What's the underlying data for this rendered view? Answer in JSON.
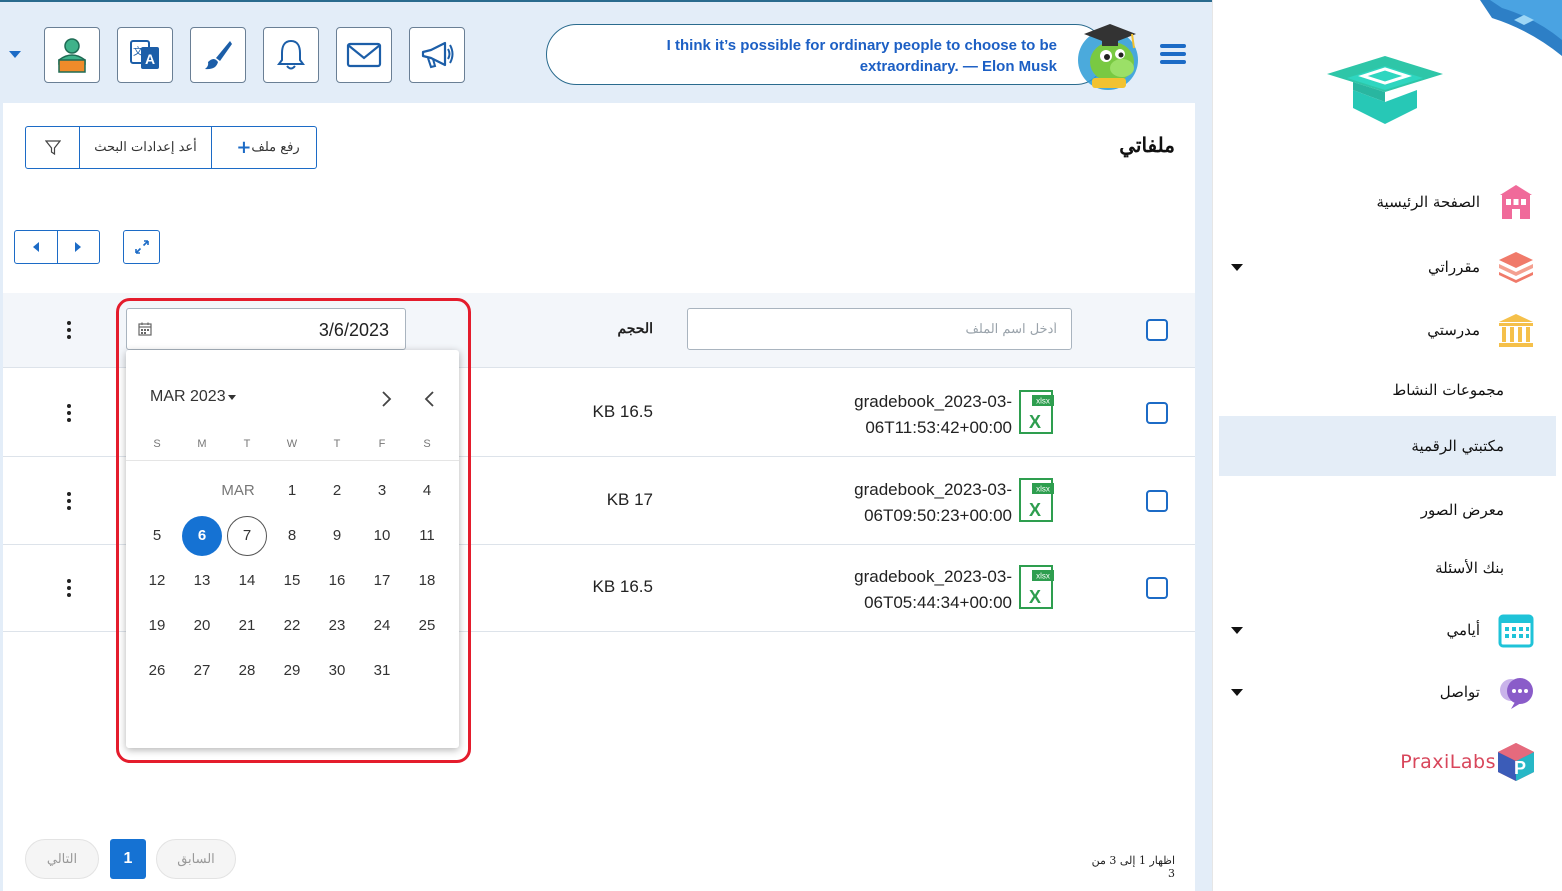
{
  "header": {
    "quote": "I think it’s possible for ordinary people to choose to be extraordinary. — Elon Musk",
    "buttons": [
      {
        "icon": "profile-icon"
      },
      {
        "icon": "translate-icon"
      },
      {
        "icon": "brush-icon"
      },
      {
        "icon": "bell-icon"
      },
      {
        "icon": "mail-icon"
      },
      {
        "icon": "megaphone-icon"
      }
    ]
  },
  "sidebar": {
    "items": [
      {
        "label": "الصفحة الرئيسية",
        "icon": "school-building-icon",
        "color": "#f06a9a"
      },
      {
        "label": "مقرراتي",
        "icon": "books-stack-icon",
        "color": "#f07a6a",
        "has_dropdown": true
      },
      {
        "label": "مدرستي",
        "icon": "institution-icon",
        "color": "#f5c04a"
      },
      {
        "label": "مجموعات النشاط"
      },
      {
        "label": "مكتبتي الرقمية",
        "active": true
      },
      {
        "label": "معرض الصور"
      },
      {
        "label": "بنك الأسئلة"
      },
      {
        "label": "أيامي",
        "icon": "calendar-icon",
        "color": "#1fc3d8",
        "has_dropdown": true
      },
      {
        "label": "تواصل",
        "icon": "chat-bubbles-icon",
        "color": "#8a5cc9",
        "has_dropdown": true
      }
    ],
    "praxilabs": "PraxiLabs"
  },
  "page": {
    "title": "ملفاتي",
    "toolbar": {
      "upload": "رفع ملف",
      "reset_search": "أعد إعدادات البحث"
    }
  },
  "table": {
    "name_placeholder": "أدخل اسم الملف",
    "size_header": "الحجم",
    "date_value": "3/6/2023",
    "rows": [
      {
        "name_line1": "gradebook_2023-03-",
        "name_line2": "06T11:53:42+00:00",
        "size": "KB 16.5"
      },
      {
        "name_line1": "gradebook_2023-03-",
        "name_line2": "06T09:50:23+00:00",
        "size": "KB 17"
      },
      {
        "name_line1": "gradebook_2023-03-",
        "name_line2": "06T05:44:34+00:00",
        "size": "KB 16.5"
      }
    ]
  },
  "datepicker": {
    "month_title": "MAR 2023",
    "month_label": "MAR",
    "weekdays": [
      "S",
      "M",
      "T",
      "W",
      "T",
      "F",
      "S"
    ],
    "selected_day": 6,
    "today_day": 7,
    "days": [
      "1",
      "2",
      "3",
      "4",
      "5",
      "6",
      "7",
      "8",
      "9",
      "10",
      "11",
      "12",
      "13",
      "14",
      "15",
      "16",
      "17",
      "18",
      "19",
      "20",
      "21",
      "22",
      "23",
      "24",
      "25",
      "26",
      "27",
      "28",
      "29",
      "30",
      "31"
    ]
  },
  "pagination": {
    "next": "التالي",
    "previous": "السابق",
    "current": "1",
    "showing": "اظهار 1 إلى 3 من 3"
  },
  "colors": {
    "primary": "#1572d3",
    "accent_border": "#1c6bc6",
    "highlight_frame": "#e41c2c",
    "header_bg": "#e3edf8"
  }
}
